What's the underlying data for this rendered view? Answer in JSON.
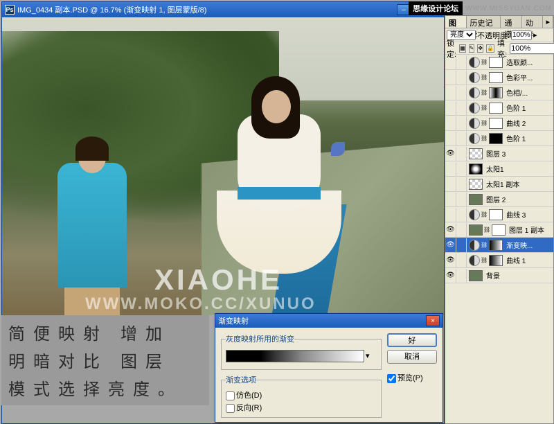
{
  "window": {
    "title": "IMG_0434 副本.PSD @ 16.7% (渐变映射 1, 图层蒙版/8)",
    "ps_icon_text": "Ps"
  },
  "watermark": {
    "text1": "XIAOHE",
    "text2": "WWW.MOKO.CC/XUNUO",
    "top_logo": "思缘设计论坛",
    "top_url": "WWW.MISSYUAN.COM"
  },
  "bottom_note": {
    "line1": "简便映射 增加",
    "line2": "明暗对比 图层",
    "line3": "模式选择亮度。"
  },
  "dialog": {
    "title": "渐变映射",
    "group1_label": "灰度映射所用的渐变",
    "group2_label": "渐变选项",
    "opt_dither": "仿色(D)",
    "opt_reverse": "反向(R)",
    "btn_ok": "好",
    "btn_cancel": "取消",
    "chk_preview": "预览(P)"
  },
  "panel": {
    "tabs": [
      "图层",
      "历史记录",
      "通道",
      "动作"
    ],
    "blend_label": "亮度",
    "opacity_label": "不透明度:",
    "opacity_val": "100%",
    "lock_label": "锁定:",
    "fill_label": "填充:",
    "fill_val": "100%",
    "layers": [
      {
        "vis": "",
        "type": "adj",
        "mask": "white",
        "name": "选取颜..."
      },
      {
        "vis": "",
        "type": "adj",
        "mask": "white",
        "name": "色彩平..."
      },
      {
        "vis": "",
        "type": "adj",
        "mask": "grad2",
        "name": "色相/..."
      },
      {
        "vis": "",
        "type": "adj",
        "mask": "white",
        "name": "色阶 1"
      },
      {
        "vis": "",
        "type": "adj",
        "mask": "white",
        "name": "曲线 2"
      },
      {
        "vis": "",
        "type": "adj",
        "mask": "black",
        "name": "色阶 1"
      },
      {
        "vis": "👁",
        "type": "checker",
        "mask": "",
        "name": "图层 3"
      },
      {
        "vis": "",
        "type": "sun",
        "mask": "",
        "name": "太阳1"
      },
      {
        "vis": "",
        "type": "checker",
        "mask": "",
        "name": "太阳1 副本"
      },
      {
        "vis": "",
        "type": "thumb",
        "mask": "",
        "name": "图层 2"
      },
      {
        "vis": "",
        "type": "adj",
        "mask": "white",
        "name": "曲线 3"
      },
      {
        "vis": "👁",
        "type": "thumb",
        "mask": "white",
        "name": "图层 1 副本",
        "chain": true
      },
      {
        "vis": "👁",
        "type": "adj",
        "mask": "grad",
        "name": "渐变映...",
        "selected": true,
        "chain": true
      },
      {
        "vis": "👁",
        "type": "adj",
        "mask": "grad",
        "name": "曲线 1"
      },
      {
        "vis": "👁",
        "type": "thumb",
        "mask": "",
        "name": "背景"
      }
    ]
  }
}
